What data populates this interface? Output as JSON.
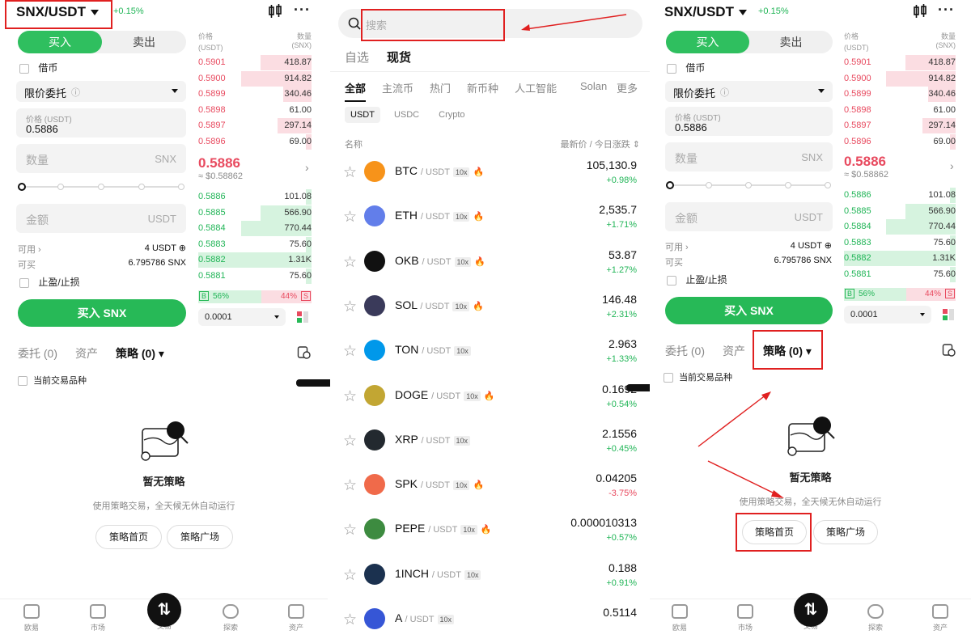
{
  "trade": {
    "pair": "SNX/USDT",
    "change": "+0.15%",
    "buy_tab": "买入",
    "sell_tab": "卖出",
    "margin_label": "借币",
    "order_type": "限价委托",
    "price_label": "价格 (USDT)",
    "price_value": "0.5886",
    "qty_placeholder": "数量",
    "qty_unit": "SNX",
    "amount_placeholder": "金额",
    "amount_unit": "USDT",
    "avail_label": "可用",
    "avail_value": "4 USDT",
    "buyable_label": "可买",
    "buyable_value": "6.795786 SNX",
    "tpsl_label": "止盈/止损",
    "buy_button": "买入 SNX",
    "ob_price_header": "价格",
    "ob_price_unit": "(USDT)",
    "ob_qty_header": "数量",
    "ob_qty_unit": "(SNX)",
    "asks": [
      {
        "price": "0.5901",
        "qty": "418.87",
        "depth": 0.45
      },
      {
        "price": "0.5900",
        "qty": "914.82",
        "depth": 0.62
      },
      {
        "price": "0.5899",
        "qty": "340.46",
        "depth": 0.25
      },
      {
        "price": "0.5898",
        "qty": "61.00",
        "depth": 0.0
      },
      {
        "price": "0.5897",
        "qty": "297.14",
        "depth": 0.3
      },
      {
        "price": "0.5896",
        "qty": "69.00",
        "depth": 0.05
      }
    ],
    "mid_price": "0.5886",
    "mid_usd": "≈ $0.58862",
    "bids": [
      {
        "price": "0.5886",
        "qty": "101.08",
        "depth": 0.05
      },
      {
        "price": "0.5885",
        "qty": "566.90",
        "depth": 0.45
      },
      {
        "price": "0.5884",
        "qty": "770.44",
        "depth": 0.62
      },
      {
        "price": "0.5883",
        "qty": "75.60",
        "depth": 0.05
      },
      {
        "price": "0.5882",
        "qty": "1.31K",
        "depth": 1.0
      },
      {
        "price": "0.5881",
        "qty": "75.60",
        "depth": 0.05
      }
    ],
    "buy_ratio_label": "B",
    "buy_ratio": "56%",
    "sell_ratio": "44%",
    "sell_ratio_label": "S",
    "buy_share": 0.56,
    "precision": "0.0001",
    "bottom_tabs": [
      "委托 (0)",
      "资产",
      "策略 (0)"
    ],
    "current_pair_label": "当前交易品种",
    "empty_title": "暂无策略",
    "empty_desc": "使用策略交易，全天候无休自动运行",
    "strategy_home": "策略首页",
    "strategy_square": "策略广场"
  },
  "nav": {
    "items": [
      "欧易",
      "市场",
      "交易",
      "探索",
      "资产"
    ]
  },
  "market": {
    "search_placeholder": "搜索",
    "top_tabs": [
      "自选",
      "现货"
    ],
    "cat_tabs": [
      "全部",
      "主流币",
      "热门",
      "新币种",
      "人工智能",
      "Solan",
      "更多"
    ],
    "quote_tabs": [
      "USDT",
      "USDC",
      "Crypto"
    ],
    "col_name": "名称",
    "col_price": "最新价 / 今日涨跌",
    "quote_suffix": "/ USDT",
    "leverage": "10x",
    "coins": [
      {
        "sym": "BTC",
        "price": "105,130.9",
        "chg": "+0.98%",
        "up": true,
        "hot": true,
        "color": "#f7931a"
      },
      {
        "sym": "ETH",
        "price": "2,535.7",
        "chg": "+1.71%",
        "up": true,
        "hot": true,
        "color": "#627eea"
      },
      {
        "sym": "OKB",
        "price": "53.87",
        "chg": "+1.27%",
        "up": true,
        "hot": true,
        "color": "#111111"
      },
      {
        "sym": "SOL",
        "price": "146.48",
        "chg": "+2.31%",
        "up": true,
        "hot": true,
        "color": "#3a3a5a"
      },
      {
        "sym": "TON",
        "price": "2.963",
        "chg": "+1.33%",
        "up": true,
        "hot": false,
        "color": "#0098ea"
      },
      {
        "sym": "DOGE",
        "price": "0.1692",
        "chg": "+0.54%",
        "up": true,
        "hot": true,
        "color": "#c2a633"
      },
      {
        "sym": "XRP",
        "price": "2.1556",
        "chg": "+0.45%",
        "up": true,
        "hot": false,
        "color": "#23292f"
      },
      {
        "sym": "SPK",
        "price": "0.04205",
        "chg": "-3.75%",
        "up": false,
        "hot": true,
        "color": "#f06a4a"
      },
      {
        "sym": "PEPE",
        "price": "0.000010313",
        "chg": "+0.57%",
        "up": true,
        "hot": true,
        "color": "#3d8b40"
      },
      {
        "sym": "1INCH",
        "price": "0.188",
        "chg": "+0.91%",
        "up": true,
        "hot": false,
        "color": "#1b314f"
      },
      {
        "sym": "A",
        "price": "0.5114",
        "chg": "",
        "up": true,
        "hot": false,
        "color": "#3656d6"
      }
    ]
  },
  "colors": {
    "green": "#27b957",
    "red": "#e84a5f",
    "annotation": "#e02020"
  }
}
